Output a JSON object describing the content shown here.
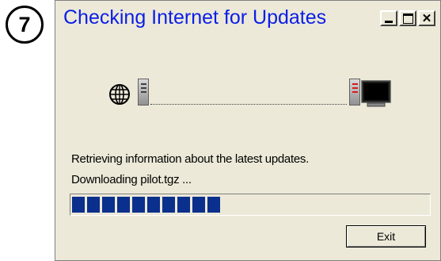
{
  "step_badge": "7",
  "window": {
    "title": "Checking Internet for Updates",
    "controls": {
      "minimize": "minimize-icon",
      "maximize": "maximize-icon",
      "close": "✕"
    }
  },
  "transfer": {
    "source_icon": "globe-server-icon",
    "target_icon": "computer-icon"
  },
  "status": {
    "line1": "Retrieving information about the latest updates.",
    "line2": "Downloading pilot.tgz ..."
  },
  "progress": {
    "percent": 42,
    "color": "#0a2f8c"
  },
  "buttons": {
    "exit": "Exit"
  },
  "colors": {
    "title": "#0b1ee6",
    "window_bg": "#ece9d8"
  }
}
